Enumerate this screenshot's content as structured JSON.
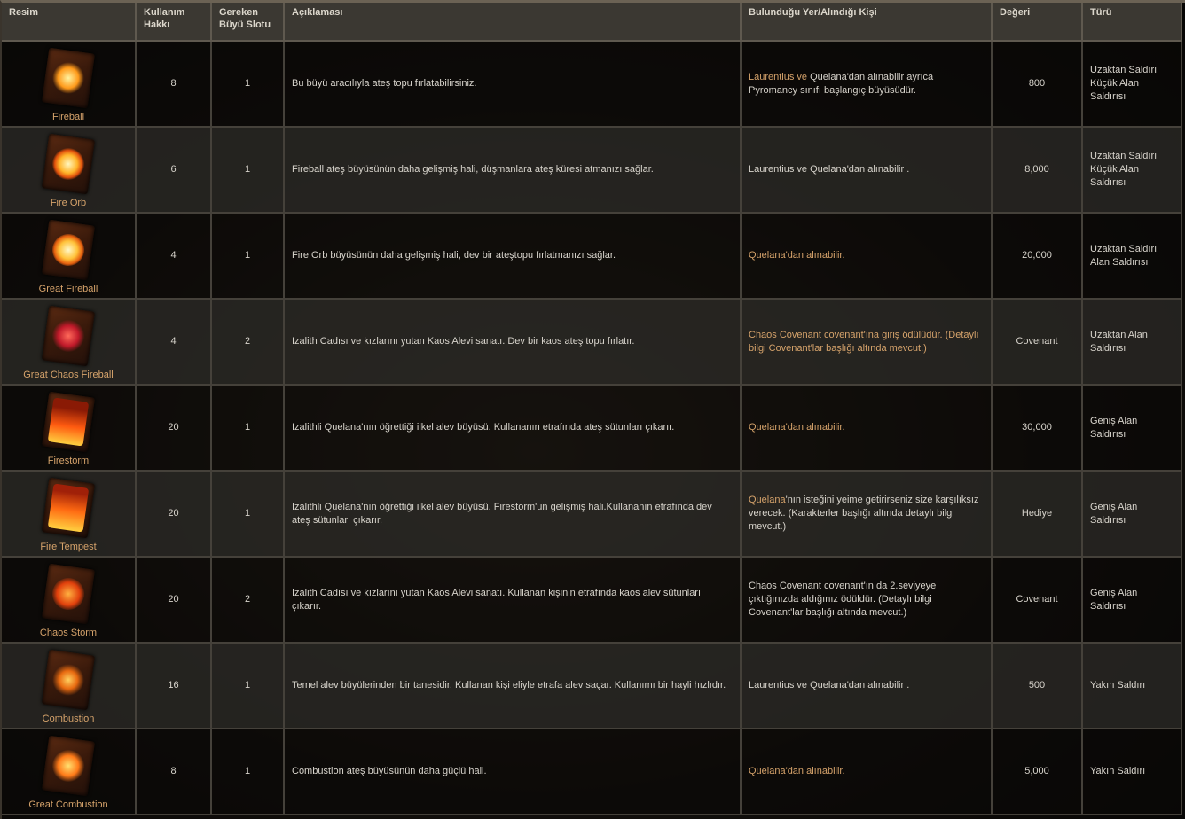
{
  "headers": {
    "image": "Resim",
    "uses": "Kullanım Hakkı",
    "slots": "Gereken Büyü Slotu",
    "description": "Açıklaması",
    "location": "Bulunduğu Yer/Alındığı Kişi",
    "value": "Değeri",
    "type": "Türü"
  },
  "rows": [
    {
      "name": "Fireball",
      "uses": "8",
      "slots": "1",
      "description": "Bu büyü aracılıyla ateş topu fırlatabilirsiniz.",
      "location_a": "Laurentius ve",
      "location_b": " Quelana'dan alınabilir ayrıca Pyromancy sınıfı başlangıç büyüsüdür.",
      "value": "800",
      "type": "Uzaktan Saldırı Küçük Alan Saldırısı",
      "icon": "fireball-icon"
    },
    {
      "name": "Fire Orb",
      "uses": "6",
      "slots": "1",
      "description": "Fireball ateş büyüsünün daha gelişmiş hali, düşmanlara ateş küresi atmanızı sağlar.",
      "location_a": "",
      "location_b": "Laurentius ve Quelana'dan alınabilir .",
      "value": "8,000",
      "type": "Uzaktan Saldırı Küçük Alan Saldırısı",
      "icon": "fire-orb-icon"
    },
    {
      "name": "Great Fireball",
      "uses": "4",
      "slots": "1",
      "description": "Fire Orb büyüsünün daha gelişmiş hali, dev bir ateştopu fırlatmanızı sağlar.",
      "location_a": "Quelana'dan alınabilir.",
      "location_b": "",
      "value": "20,000",
      "type": "Uzaktan Saldırı Alan Saldırısı",
      "icon": "great-fireball-icon"
    },
    {
      "name": "Great Chaos Fireball",
      "uses": "4",
      "slots": "2",
      "description": "Izalith Cadısı ve kızlarını yutan Kaos Alevi sanatı. Dev bir kaos ateş topu fırlatır.",
      "location_a": "Chaos Covenant covenant'ına giriş ödülüdür. (Detaylı bilgi Covenant'lar başlığı altında mevcut.)",
      "location_b": "",
      "value": "Covenant",
      "type": "Uzaktan Alan Saldırısı",
      "icon": "great-chaos-fireball-icon"
    },
    {
      "name": "Firestorm",
      "uses": "20",
      "slots": "1",
      "description": "Izalithli Quelana'nın öğrettiği ilkel alev büyüsü. Kullananın etrafında ateş sütunları çıkarır.",
      "location_a": "Quelana'dan alınabilir.",
      "location_b": "",
      "value": "30,000",
      "type": "Geniş Alan Saldırısı",
      "icon": "firestorm-icon"
    },
    {
      "name": "Fire Tempest",
      "uses": "20",
      "slots": "1",
      "description": "Izalithli Quelana'nın öğrettiği ilkel alev büyüsü. Firestorm'un gelişmiş hali.Kullananın etrafında dev ateş sütunları çıkarır.",
      "location_a": "Quelana",
      "location_b": "'nın isteğini yeime getirirseniz size karşılıksız verecek. (Karakterler başlığı altında detaylı bilgi mevcut.)",
      "value": "Hediye",
      "type": "Geniş Alan Saldırısı",
      "icon": "fire-tempest-icon"
    },
    {
      "name": "Chaos Storm",
      "uses": "20",
      "slots": "2",
      "description": "Izalith Cadısı ve kızlarını yutan Kaos Alevi sanatı. Kullanan kişinin etrafında kaos alev sütunları çıkarır.",
      "location_a": "",
      "location_b": "Chaos Covenant covenant'ın da 2.seviyeye çıktığınızda aldığınız ödüldür. (Detaylı bilgi Covenant'lar başlığı altında mevcut.)",
      "value": "Covenant",
      "type": "Geniş Alan Saldırısı",
      "icon": "chaos-storm-icon"
    },
    {
      "name": "Combustion",
      "uses": "16",
      "slots": "1",
      "description": "Temel alev büyülerinden bir tanesidir. Kullanan kişi eliyle etrafa alev saçar. Kullanımı bir hayli hızlıdır.",
      "location_a": "",
      "location_b": "Laurentius ve Quelana'dan alınabilir .",
      "value": "500",
      "type": "Yakın Saldırı",
      "icon": "combustion-icon"
    },
    {
      "name": "Great Combustion",
      "uses": "8",
      "slots": "1",
      "description": "Combustion ateş büyüsünün daha güçlü hali.",
      "location_a": "Quelana'dan alınabilir.",
      "location_b": "",
      "value": "5,000",
      "type": "Yakın Saldırı",
      "icon": "great-combustion-icon"
    }
  ],
  "colors": {
    "accent": "#d6a36b",
    "header_bg": "#3b3832",
    "row_dark": "#0c0a08",
    "row_light": "#2a2724"
  }
}
